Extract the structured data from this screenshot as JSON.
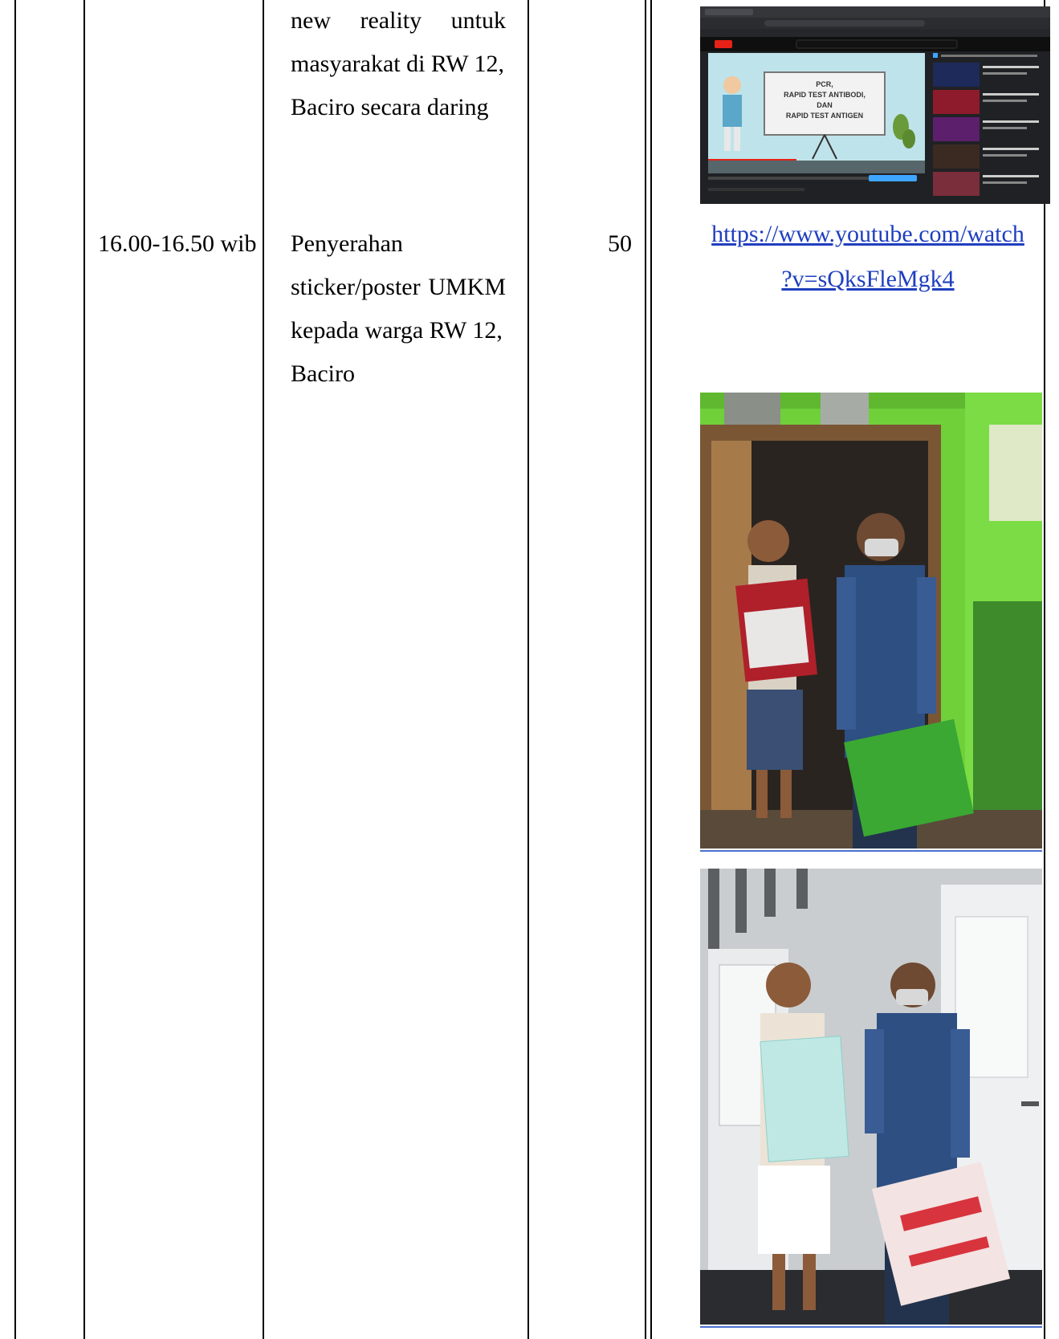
{
  "rows": {
    "previous": {
      "activity_lines": [
        "new reality untuk",
        "masyarakat di RW 12,",
        "Baciro secara daring"
      ]
    },
    "current": {
      "time": "16.00-16.50 wib",
      "activity_lines": [
        "Penyerahan",
        "sticker/poster UMKM",
        "kepada warga RW 12,",
        "Baciro"
      ],
      "participants": "50"
    }
  },
  "documentation": {
    "video_link_lines": [
      "https://www.youtube.com/watch",
      "?v=sQksFleMgk4"
    ],
    "video_screenshot": {
      "slide_lines": [
        "PCR,",
        "RAPID TEST ANTIBODI,",
        "DAN",
        "RAPID TEST ANTIGEN"
      ]
    }
  },
  "colors": {
    "border": "#000000",
    "link": "#1f3fbf",
    "wall_green": "#6fd03a",
    "wall_gray": "#c9cdd0"
  }
}
